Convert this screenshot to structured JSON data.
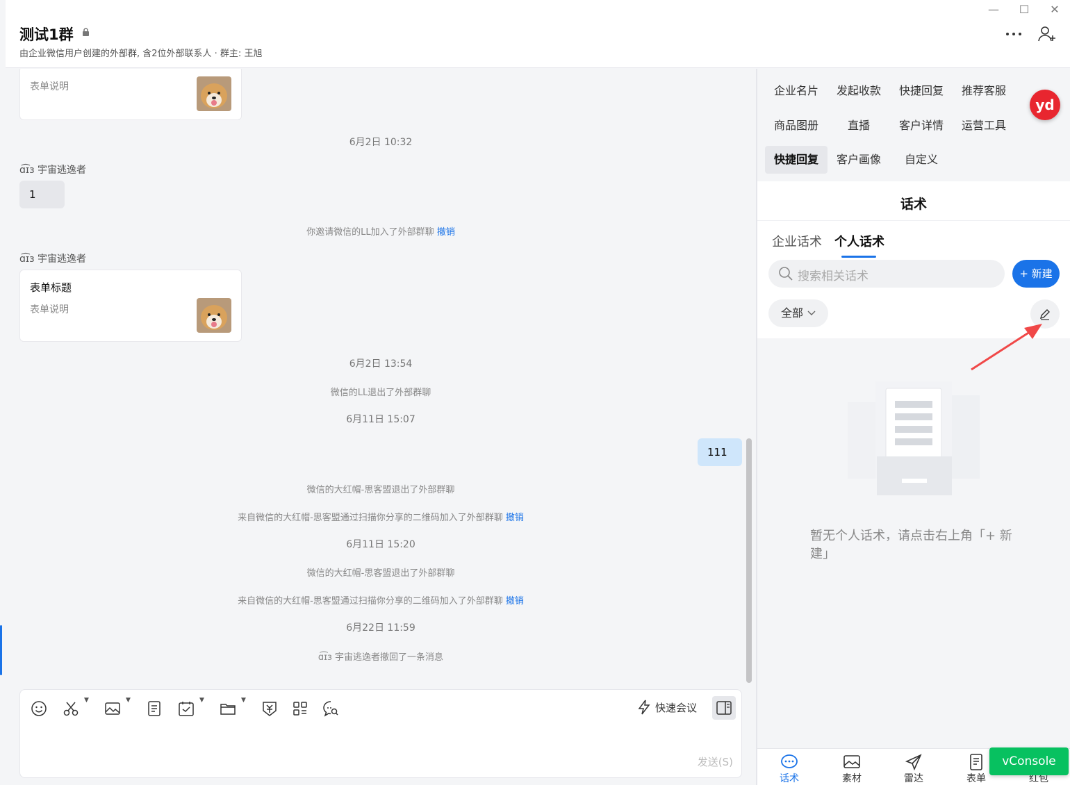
{
  "window": {
    "minimize_icon": "minimize-icon",
    "maximize_icon": "maximize-icon",
    "close_icon": "close-icon"
  },
  "header": {
    "title": "测试1群",
    "subtitle": "由企业微信用户创建的外部群, 含2位外部联系人 · 群主: 王旭",
    "more_icon": "more-icon",
    "add_member_icon": "add-member-icon"
  },
  "chat": {
    "card1": {
      "desc": "表单说明"
    },
    "time1": "6月2日 10:32",
    "sender1": "ɑ͡ɪɜ 宇宙逃逸者",
    "bubble1": "1",
    "sys1": {
      "text": "你邀请微信的LL加入了外部群聊",
      "link": "撤销"
    },
    "sender2": "ɑ͡ɪɜ 宇宙逃逸者",
    "card2": {
      "title": "表单标题",
      "desc": "表单说明"
    },
    "time2": "6月2日 13:54",
    "sys2": "微信的LL退出了外部群聊",
    "time3": "6月11日 15:07",
    "bubble_me": "111",
    "sys3": "微信的大红帽-思客盟退出了外部群聊",
    "sys4": {
      "text": "来自微信的大红帽-思客盟通过扫描你分享的二维码加入了外部群聊",
      "link": "撤销"
    },
    "time4": "6月11日 15:20",
    "sys5": "微信的大红帽-思客盟退出了外部群聊",
    "sys6": {
      "text": "来自微信的大红帽-思客盟通过扫描你分享的二维码加入了外部群聊",
      "link": "撤销"
    },
    "time5": "6月22日 11:59",
    "sys7": "ɑ͡ɪɜ 宇宙逃逸者撤回了一条消息"
  },
  "composer": {
    "quick_meeting": "快速会议",
    "send": "发送(S)"
  },
  "side": {
    "menu": [
      "企业名片",
      "发起收款",
      "快捷回复",
      "推荐客服",
      "商品图册",
      "直播",
      "客户详情",
      "运营工具",
      "快捷回复",
      "客户画像",
      "自定义"
    ],
    "avatar_badge": "yd",
    "panel_title": "话术",
    "tabs": [
      "企业话术",
      "个人话术"
    ],
    "search_placeholder": "搜索相关话术",
    "new_button": "+ 新建",
    "filter": "全部",
    "empty_text": "暂无个人话术，请点击右上角「+ 新建」",
    "bottom_nav": [
      "话术",
      "素材",
      "雷达",
      "表单",
      "红包"
    ]
  },
  "vconsole": "vConsole",
  "colors": {
    "accent": "#1a73e8",
    "vconsole": "#07c160",
    "badge": "#e8262f"
  }
}
